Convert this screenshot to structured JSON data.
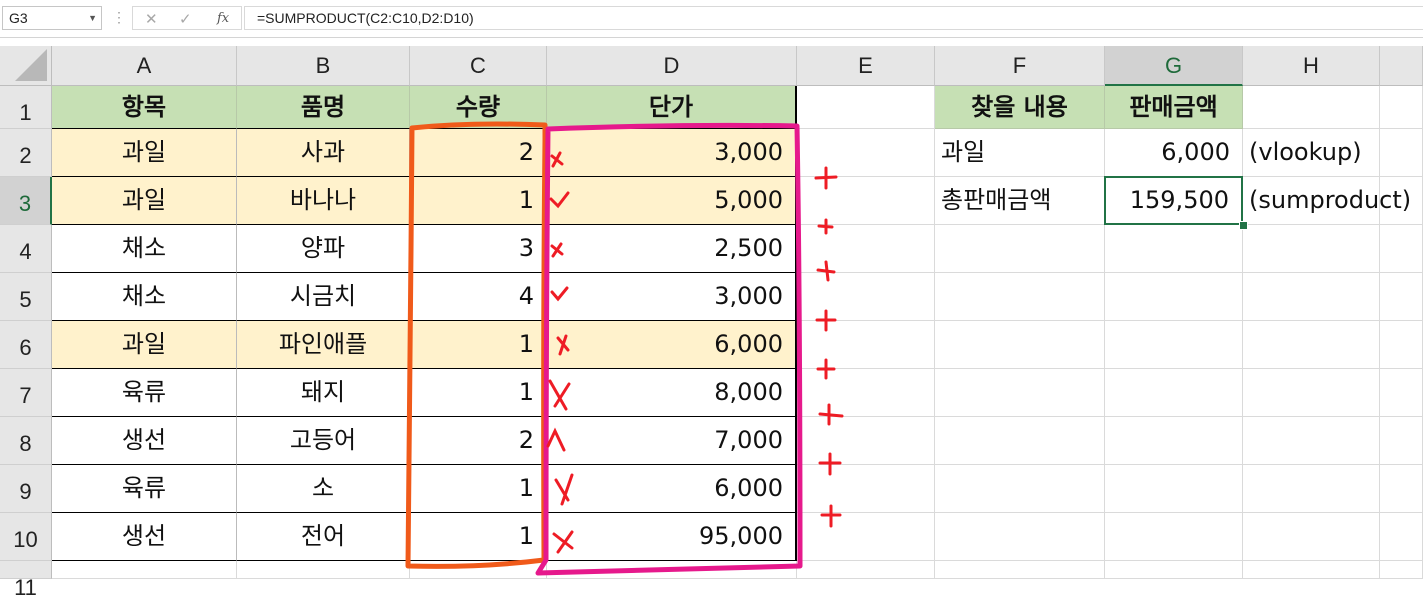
{
  "formula_bar": {
    "name_box": "G3",
    "formula": "=SUMPRODUCT(C2:C10,D2:D10)",
    "cancel_icon": "close-icon",
    "enter_icon": "check-icon",
    "fx_label": "fx"
  },
  "columns": [
    "A",
    "B",
    "C",
    "D",
    "E",
    "F",
    "G",
    "H"
  ],
  "selected_column": "G",
  "rows": [
    "1",
    "2",
    "3",
    "4",
    "5",
    "6",
    "7",
    "8",
    "9",
    "10",
    "11"
  ],
  "selected_row": "3",
  "table": {
    "headers": [
      "항목",
      "품명",
      "수량",
      "단가"
    ],
    "rows": [
      {
        "category": "과일",
        "product": "사과",
        "qty": "2",
        "price": "3,000"
      },
      {
        "category": "과일",
        "product": "바나나",
        "qty": "1",
        "price": "5,000"
      },
      {
        "category": "채소",
        "product": "양파",
        "qty": "3",
        "price": "2,500"
      },
      {
        "category": "채소",
        "product": "시금치",
        "qty": "4",
        "price": "3,000"
      },
      {
        "category": "과일",
        "product": "파인애플",
        "qty": "1",
        "price": "6,000"
      },
      {
        "category": "육류",
        "product": "돼지",
        "qty": "1",
        "price": "8,000"
      },
      {
        "category": "생선",
        "product": "고등어",
        "qty": "2",
        "price": "7,000"
      },
      {
        "category": "육류",
        "product": "소",
        "qty": "1",
        "price": "6,000"
      },
      {
        "category": "생선",
        "product": "전어",
        "qty": "1",
        "price": "95,000"
      }
    ]
  },
  "lookup": {
    "headers": [
      "찾을 내용",
      "판매금액"
    ],
    "rows": [
      {
        "label": "과일",
        "value": "6,000",
        "note": "(vlookup)"
      },
      {
        "label": "총판매금액",
        "value": "159,500",
        "note": "(sumproduct)"
      }
    ]
  },
  "colors": {
    "header_green": "#c6e0b4",
    "fruit_highlight": "#fff2cc",
    "selection_green": "#217346",
    "annotation_orange": "#f05a1a",
    "annotation_magenta": "#e6198c",
    "annotation_red": "#ee1c25"
  }
}
